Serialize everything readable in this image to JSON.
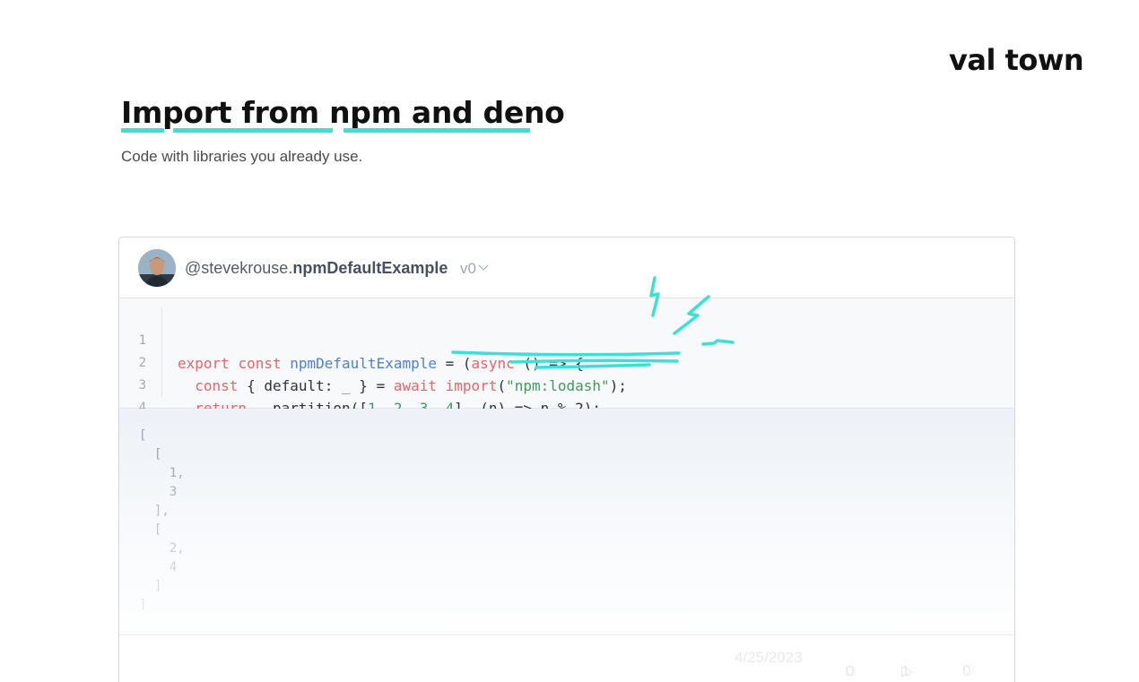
{
  "brand": {
    "logo_text": "val town"
  },
  "header": {
    "title": "Import from npm and deno",
    "subtitle": "Code with libraries you already use."
  },
  "card": {
    "author": "@stevekrouse.",
    "val_name": "npmDefaultExample",
    "version": "v0",
    "code_lines": [
      {
        "num": "1"
      },
      {
        "num": "2"
      },
      {
        "num": "3"
      },
      {
        "num": "4"
      }
    ],
    "code_tokens": {
      "l1": {
        "export": "export",
        "const": "const",
        "name": "npmDefaultExample",
        "eq": " = (",
        "async": "async",
        "rest": " () => {"
      },
      "l2": {
        "const": "const",
        "mid": " { default: ",
        "us": "_",
        "mid2": " } = ",
        "await": "await",
        "import": "import",
        "open": "(",
        "str": "\"npm:lodash\"",
        "close": ");"
      },
      "l3": {
        "return": "return",
        "mid": " ",
        "us": "_",
        "call": ".partition([",
        "n1": "1",
        "c1": ", ",
        "n2": "2",
        "c2": ", ",
        "n3": "3",
        "c3": ", ",
        "n4": "4",
        "end": "], (n) => n % 2);"
      },
      "l4": {
        "text": "})();"
      }
    },
    "output_lines": [
      "[",
      "  [",
      "    1,",
      "    3",
      "  ],",
      "  [",
      "    2,",
      "    4",
      "  ]",
      "]"
    ],
    "footer": {
      "date": "4/25/2023",
      "comments": "0",
      "runs": "1",
      "likes": "0"
    }
  },
  "colors": {
    "accent": "#3ce0d8",
    "keyword": "#e8636a",
    "function_name": "#4f7ed8",
    "string": "#3d9a5c"
  }
}
